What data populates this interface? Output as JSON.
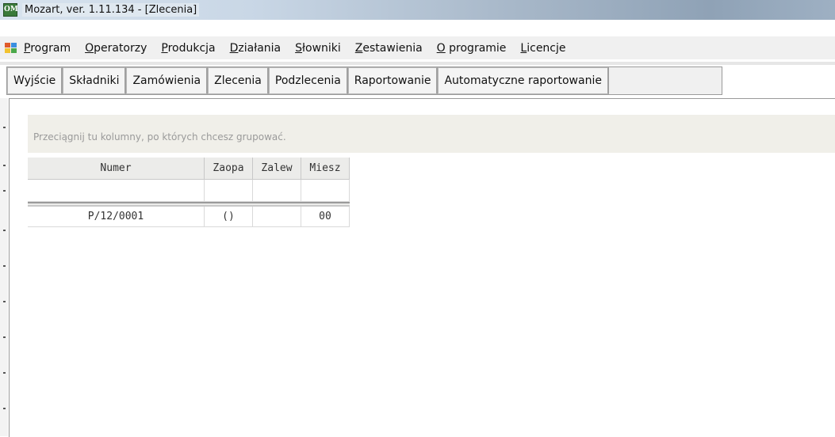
{
  "window": {
    "title": "Mozart, ver. 1.11.134 - [Zlecenia]",
    "icon_text": "OM"
  },
  "menu": {
    "items": [
      "Program",
      "Operatorzy",
      "Produkcja",
      "Działania",
      "Słowniki",
      "Zestawienia",
      "O programie",
      "Licencje"
    ]
  },
  "toolbar": {
    "buttons": [
      "Wyjście",
      "Składniki",
      "Zamówienia",
      "Zlecenia",
      "Podzlecenia",
      "Raportowanie",
      "Automatyczne raportowanie"
    ]
  },
  "grid": {
    "group_hint": "Przeciągnij tu kolumny, po których chcesz grupować.",
    "columns": [
      "Numer",
      "Zaopa",
      "Zalew",
      "Miesz"
    ],
    "rows": [
      [
        "P/12/0001",
        "()",
        "",
        "00"
      ]
    ]
  }
}
